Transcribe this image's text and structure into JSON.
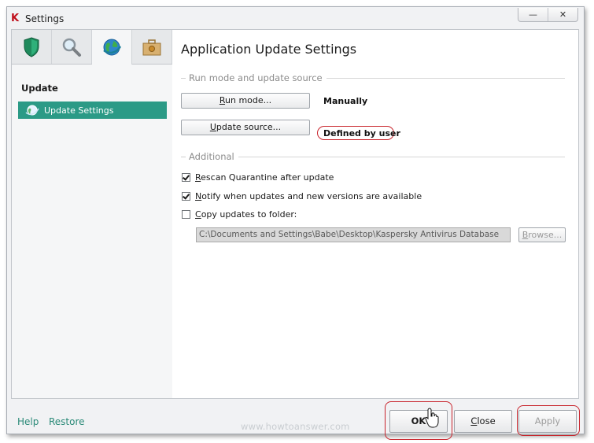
{
  "window": {
    "title": "Settings",
    "controls": [
      "—",
      "✕"
    ]
  },
  "sidebar": {
    "tabs": [
      {
        "name": "protection-tab",
        "icon": "shield-icon"
      },
      {
        "name": "scan-tab",
        "icon": "magnifier-icon"
      },
      {
        "name": "update-tab",
        "icon": "globe-icon",
        "active": true
      },
      {
        "name": "options-tab",
        "icon": "toolbox-icon"
      }
    ],
    "section_title": "Update",
    "items": [
      {
        "label": "Update Settings",
        "icon": "globe-icon",
        "selected": true
      }
    ]
  },
  "main": {
    "heading": "Application Update Settings",
    "run_group": {
      "label": "Run mode and update source",
      "run_mode_button": {
        "underline": "R",
        "rest": "un mode..."
      },
      "run_mode_value": "Manually",
      "update_source_button": {
        "underline": "U",
        "rest": "pdate source..."
      },
      "update_source_value": "Defined by user"
    },
    "additional_group": {
      "label": "Additional",
      "options": [
        {
          "underline": "R",
          "rest": "escan Quarantine after update",
          "checked": true
        },
        {
          "underline": "N",
          "rest": "otify when updates and new versions are available",
          "checked": true
        },
        {
          "underline": "C",
          "rest": "opy updates to folder:",
          "checked": false
        }
      ],
      "folder_path": "C:\\Documents and Settings\\Babe\\Desktop\\Kaspersky Antivirus Database",
      "browse_button": {
        "underline": "B",
        "rest": "rowse..."
      }
    }
  },
  "footer": {
    "help_label": "Help",
    "restore_label": "Restore",
    "watermark": "www.howtoanswer.com",
    "ok_label": "OK",
    "close_button": {
      "underline": "C",
      "rest": "lose"
    },
    "apply_label": "Apply"
  },
  "colors": {
    "accent": "#2b9a86",
    "highlight_ring": "#c8232b"
  }
}
